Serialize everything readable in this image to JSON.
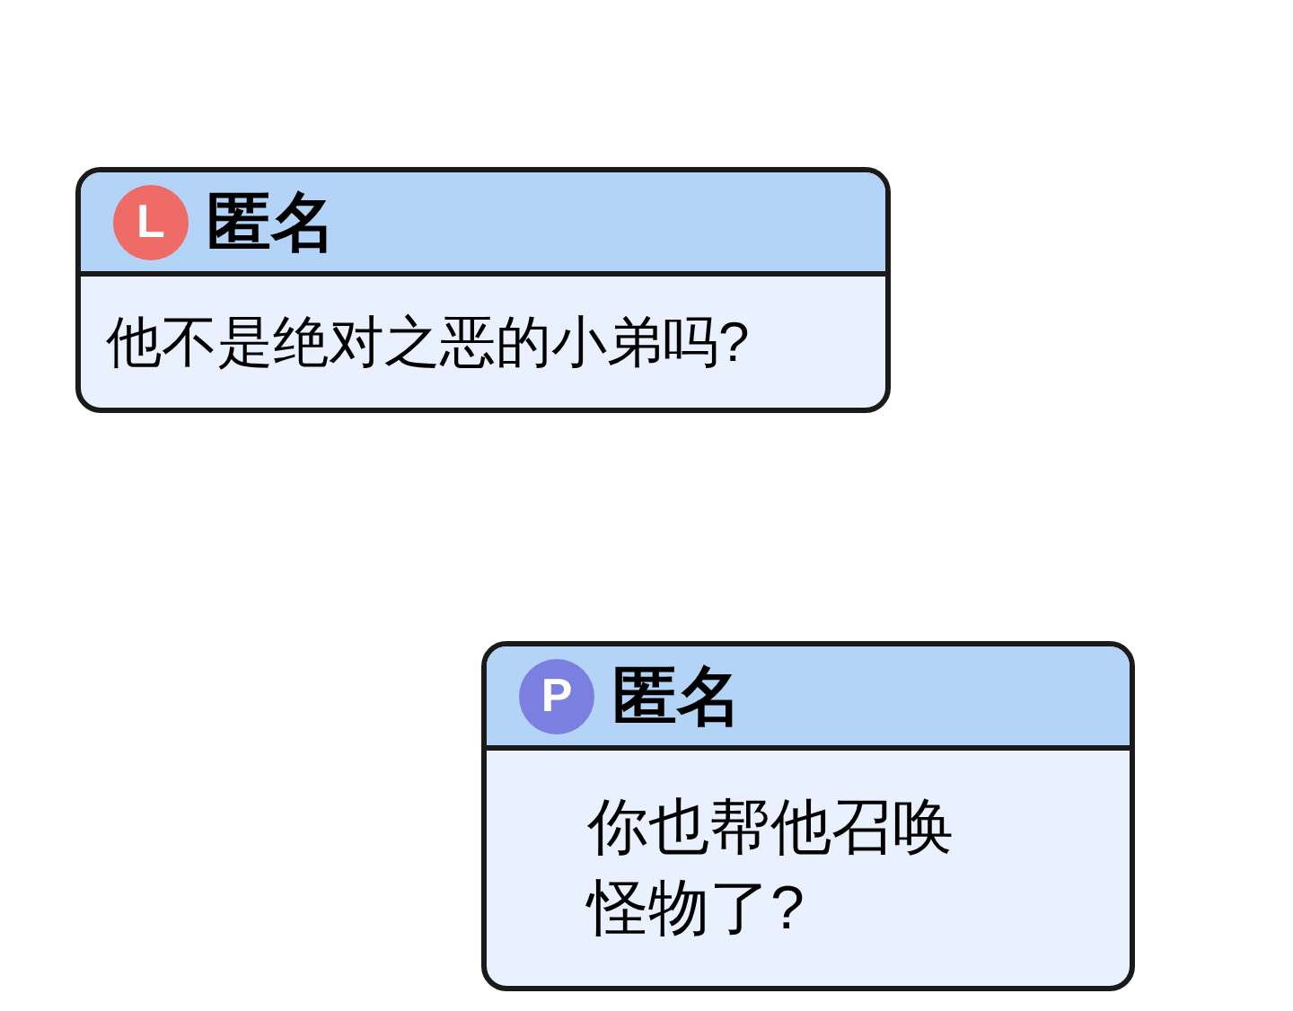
{
  "messages": [
    {
      "avatar": {
        "letter": "L",
        "color": "#ee6b66"
      },
      "sender": "匿名",
      "text": "他不是绝对之恶的小弟吗?"
    },
    {
      "avatar": {
        "letter": "P",
        "color": "#7b7fe0"
      },
      "sender": "匿名",
      "text": "你也帮他召唤怪物了?"
    }
  ]
}
